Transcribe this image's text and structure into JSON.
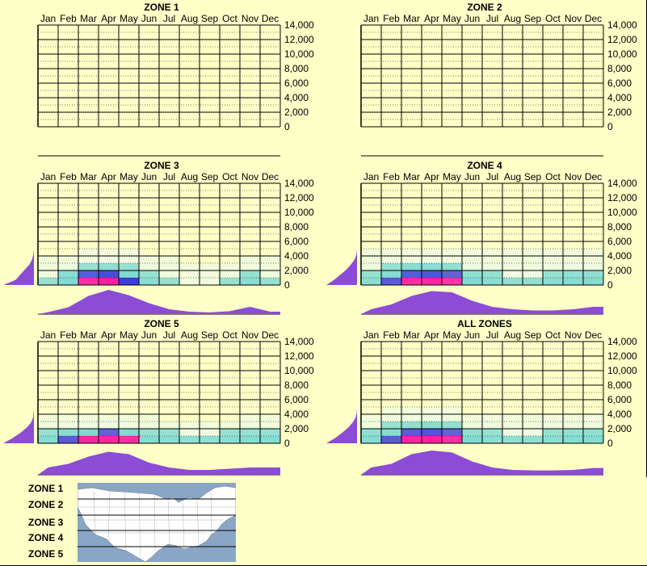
{
  "months": [
    "Jan",
    "Feb",
    "Mar",
    "Apr",
    "May",
    "Jun",
    "Jul",
    "Aug",
    "Sep",
    "Oct",
    "Nov",
    "Dec"
  ],
  "y_ticks": [
    "14,000",
    "12,000",
    "10,000",
    "8,000",
    "6,000",
    "4,000",
    "2,000",
    "0"
  ],
  "legend_labels": [
    "ZONE 1",
    "ZONE 2",
    "ZONE 3",
    "ZONE 4",
    "ZONE 5"
  ],
  "colors": {
    "background": "#ffffc8",
    "density_low": "#dff7f7",
    "density_mid": "#40c8d8",
    "density_high": "#2020e0",
    "density_peak": "#ff1f9f",
    "profile": "#8c4cd6",
    "map_water": "#8aa6c6",
    "map_land": "#ffffff"
  },
  "chart_data": [
    {
      "type": "heatmap",
      "title": "ZONE 1",
      "x_categories": [
        "Jan",
        "Feb",
        "Mar",
        "Apr",
        "May",
        "Jun",
        "Jul",
        "Aug",
        "Sep",
        "Oct",
        "Nov",
        "Dec"
      ],
      "y_ticks": [
        0,
        2000,
        4000,
        6000,
        8000,
        10000,
        12000,
        14000
      ],
      "ylim": [
        0,
        14000
      ],
      "grid": true,
      "has_data": false,
      "month_profile": [],
      "elevation_profile": []
    },
    {
      "type": "heatmap",
      "title": "ZONE 2",
      "x_categories": [
        "Jan",
        "Feb",
        "Mar",
        "Apr",
        "May",
        "Jun",
        "Jul",
        "Aug",
        "Sep",
        "Oct",
        "Nov",
        "Dec"
      ],
      "y_ticks": [
        0,
        2000,
        4000,
        6000,
        8000,
        10000,
        12000,
        14000
      ],
      "ylim": [
        0,
        14000
      ],
      "grid": true,
      "has_data": false,
      "month_profile": [],
      "elevation_profile": []
    },
    {
      "type": "heatmap",
      "title": "ZONE 3",
      "x_categories": [
        "Jan",
        "Feb",
        "Mar",
        "Apr",
        "May",
        "Jun",
        "Jul",
        "Aug",
        "Sep",
        "Oct",
        "Nov",
        "Dec"
      ],
      "y_ticks": [
        0,
        2000,
        4000,
        6000,
        8000,
        10000,
        12000,
        14000
      ],
      "ylim": [
        0,
        14000
      ],
      "grid": true,
      "has_data": true,
      "month_profile": [
        0.08,
        0.28,
        0.75,
        1.0,
        0.78,
        0.45,
        0.2,
        0.1,
        0.07,
        0.12,
        0.3,
        0.1
      ],
      "elevation_profile": [
        1.0,
        0.6,
        0.45,
        0.3,
        0.15,
        0.06,
        0.02,
        0.0
      ],
      "cells": [
        [
          0.3,
          0.5,
          0.9,
          1.0,
          0.8,
          0.4,
          0.3,
          0.2,
          0.2,
          0.3,
          0.4,
          0.3
        ],
        [
          0.2,
          0.4,
          0.6,
          0.7,
          0.5,
          0.3,
          0.2,
          0.1,
          0.1,
          0.2,
          0.3,
          0.2
        ],
        [
          0.1,
          0.2,
          0.3,
          0.35,
          0.3,
          0.2,
          0.1,
          0.05,
          0.05,
          0.1,
          0.1,
          0.1
        ],
        [
          0.05,
          0.1,
          0.15,
          0.2,
          0.2,
          0.1,
          0.05,
          0.0,
          0.0,
          0.0,
          0.05,
          0.05
        ],
        [
          0.0,
          0.0,
          0.05,
          0.05,
          0.05,
          0.0,
          0.0,
          0.0,
          0.0,
          0.0,
          0.0,
          0.0
        ]
      ]
    },
    {
      "type": "heatmap",
      "title": "ZONE 4",
      "x_categories": [
        "Jan",
        "Feb",
        "Mar",
        "Apr",
        "May",
        "Jun",
        "Jul",
        "Aug",
        "Sep",
        "Oct",
        "Nov",
        "Dec"
      ],
      "y_ticks": [
        0,
        2000,
        4000,
        6000,
        8000,
        10000,
        12000,
        14000
      ],
      "ylim": [
        0,
        14000
      ],
      "grid": true,
      "has_data": true,
      "month_profile": [
        0.2,
        0.4,
        0.75,
        0.95,
        0.9,
        0.55,
        0.3,
        0.2,
        0.15,
        0.15,
        0.2,
        0.3
      ],
      "elevation_profile": [
        1.0,
        0.75,
        0.55,
        0.35,
        0.2,
        0.08,
        0.02,
        0.0
      ],
      "cells": [
        [
          0.4,
          0.6,
          0.9,
          0.95,
          0.85,
          0.5,
          0.4,
          0.35,
          0.35,
          0.4,
          0.45,
          0.45
        ],
        [
          0.3,
          0.45,
          0.6,
          0.65,
          0.55,
          0.35,
          0.3,
          0.25,
          0.25,
          0.3,
          0.35,
          0.35
        ],
        [
          0.2,
          0.3,
          0.4,
          0.4,
          0.35,
          0.25,
          0.2,
          0.2,
          0.2,
          0.2,
          0.25,
          0.25
        ],
        [
          0.1,
          0.15,
          0.2,
          0.25,
          0.2,
          0.15,
          0.1,
          0.1,
          0.1,
          0.1,
          0.1,
          0.1
        ],
        [
          0.05,
          0.05,
          0.1,
          0.1,
          0.05,
          0.05,
          0.05,
          0.05,
          0.05,
          0.05,
          0.05,
          0.05
        ]
      ]
    },
    {
      "type": "heatmap",
      "title": "ZONE 5",
      "x_categories": [
        "Jan",
        "Feb",
        "Mar",
        "Apr",
        "May",
        "Jun",
        "Jul",
        "Aug",
        "Sep",
        "Oct",
        "Nov",
        "Dec"
      ],
      "y_ticks": [
        0,
        2000,
        4000,
        6000,
        8000,
        10000,
        12000,
        14000
      ],
      "ylim": [
        0,
        14000
      ],
      "grid": true,
      "has_data": true,
      "month_profile": [
        0.3,
        0.45,
        0.75,
        0.95,
        0.85,
        0.5,
        0.3,
        0.2,
        0.2,
        0.25,
        0.3,
        0.3
      ],
      "elevation_profile": [
        1.0,
        0.7,
        0.45,
        0.25,
        0.1,
        0.03,
        0.01,
        0.0
      ],
      "cells": [
        [
          0.45,
          0.6,
          0.95,
          0.95,
          0.9,
          0.45,
          0.4,
          0.35,
          0.35,
          0.4,
          0.45,
          0.45
        ],
        [
          0.3,
          0.4,
          0.5,
          0.55,
          0.5,
          0.3,
          0.3,
          0.25,
          0.25,
          0.3,
          0.3,
          0.3
        ],
        [
          0.15,
          0.2,
          0.25,
          0.25,
          0.2,
          0.15,
          0.15,
          0.1,
          0.1,
          0.15,
          0.15,
          0.15
        ],
        [
          0.05,
          0.05,
          0.1,
          0.1,
          0.05,
          0.05,
          0.0,
          0.0,
          0.0,
          0.0,
          0.05,
          0.05
        ],
        [
          0.0,
          0.0,
          0.0,
          0.0,
          0.0,
          0.0,
          0.0,
          0.0,
          0.0,
          0.0,
          0.0,
          0.0
        ]
      ]
    },
    {
      "type": "heatmap",
      "title": "ALL ZONES",
      "x_categories": [
        "Jan",
        "Feb",
        "Mar",
        "Apr",
        "May",
        "Jun",
        "Jul",
        "Aug",
        "Sep",
        "Oct",
        "Nov",
        "Dec"
      ],
      "y_ticks": [
        0,
        2000,
        4000,
        6000,
        8000,
        10000,
        12000,
        14000
      ],
      "ylim": [
        0,
        14000
      ],
      "grid": true,
      "has_data": true,
      "month_profile": [
        0.3,
        0.45,
        0.85,
        1.0,
        0.92,
        0.55,
        0.3,
        0.2,
        0.18,
        0.18,
        0.2,
        0.28
      ],
      "elevation_profile": [
        1.0,
        0.72,
        0.5,
        0.3,
        0.15,
        0.05,
        0.01,
        0.0
      ],
      "cells": [
        [
          0.45,
          0.6,
          0.95,
          1.0,
          0.9,
          0.5,
          0.4,
          0.35,
          0.35,
          0.4,
          0.45,
          0.45
        ],
        [
          0.35,
          0.45,
          0.6,
          0.65,
          0.55,
          0.35,
          0.3,
          0.25,
          0.25,
          0.3,
          0.35,
          0.35
        ],
        [
          0.2,
          0.3,
          0.35,
          0.4,
          0.35,
          0.2,
          0.2,
          0.15,
          0.15,
          0.2,
          0.2,
          0.2
        ],
        [
          0.1,
          0.15,
          0.2,
          0.25,
          0.2,
          0.1,
          0.1,
          0.05,
          0.05,
          0.1,
          0.1,
          0.1
        ],
        [
          0.0,
          0.05,
          0.05,
          0.05,
          0.05,
          0.0,
          0.0,
          0.0,
          0.0,
          0.0,
          0.0,
          0.0
        ]
      ]
    }
  ]
}
